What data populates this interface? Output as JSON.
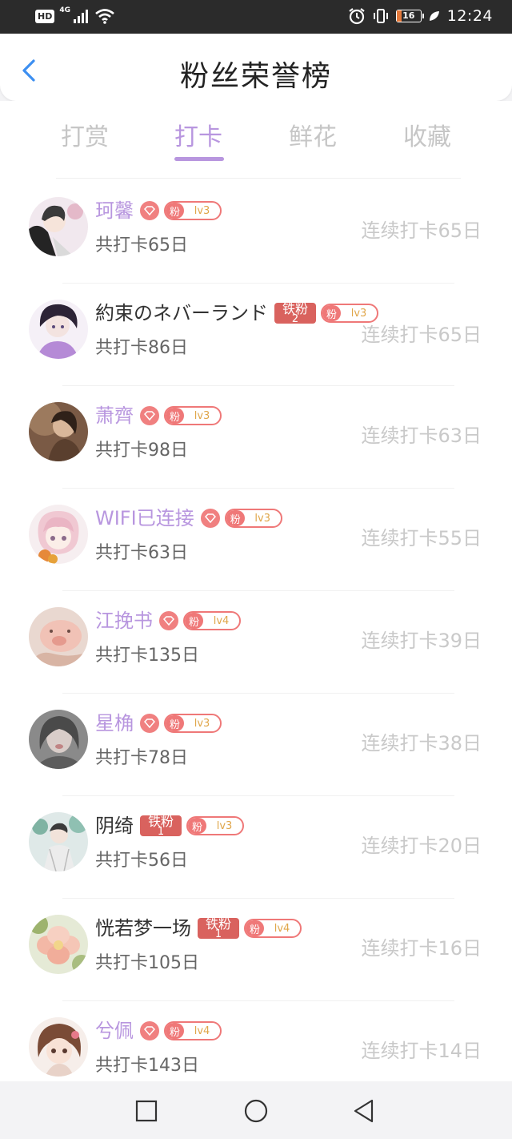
{
  "status_bar": {
    "hd": "HD",
    "network": "4G",
    "battery": "16",
    "time": "12:24"
  },
  "header": {
    "title": "粉丝荣誉榜",
    "back_icon": "chevron-left-icon"
  },
  "tabs": [
    {
      "label": "打赏",
      "active": false
    },
    {
      "label": "打卡",
      "active": true
    },
    {
      "label": "鲜花",
      "active": false
    },
    {
      "label": "收藏",
      "active": false
    }
  ],
  "colors": {
    "accent": "#b896df",
    "badge_red": "#ef7878",
    "iron_red": "#d9625e"
  },
  "list": [
    {
      "name": "珂馨",
      "vip": true,
      "badge": "diamond",
      "fan_label": "粉",
      "level": "lv3",
      "total": "共打卡65日",
      "streak": "连续打卡65日"
    },
    {
      "name": "約束のネバーランド",
      "vip": false,
      "badge": "iron",
      "iron_text": "铁粉",
      "iron_num": "2",
      "fan_label": "粉",
      "level": "lv3",
      "total": "共打卡86日",
      "streak": "连续打卡65日"
    },
    {
      "name": "萧齊",
      "vip": true,
      "badge": "diamond",
      "fan_label": "粉",
      "level": "lv3",
      "total": "共打卡98日",
      "streak": "连续打卡63日"
    },
    {
      "name": "WIFI已连接",
      "vip": true,
      "badge": "diamond",
      "fan_label": "粉",
      "level": "lv3",
      "total": "共打卡63日",
      "streak": "连续打卡55日"
    },
    {
      "name": "江挽书",
      "vip": true,
      "badge": "diamond",
      "fan_label": "粉",
      "level": "lv4",
      "total": "共打卡135日",
      "streak": "连续打卡39日"
    },
    {
      "name": "星桷",
      "vip": true,
      "badge": "diamond",
      "fan_label": "粉",
      "level": "lv3",
      "total": "共打卡78日",
      "streak": "连续打卡38日"
    },
    {
      "name": "阴绮",
      "vip": false,
      "badge": "iron",
      "iron_text": "铁粉",
      "iron_num": "1",
      "fan_label": "粉",
      "level": "lv3",
      "total": "共打卡56日",
      "streak": "连续打卡20日"
    },
    {
      "name": "恍若梦一场",
      "vip": false,
      "badge": "iron",
      "iron_text": "铁粉",
      "iron_num": "1",
      "fan_label": "粉",
      "level": "lv4",
      "total": "共打卡105日",
      "streak": "连续打卡16日"
    },
    {
      "name": "兮佩",
      "vip": true,
      "badge": "diamond",
      "fan_label": "粉",
      "level": "lv4",
      "total": "共打卡143日",
      "streak": "连续打卡14日"
    }
  ],
  "nav_bar": {
    "buttons": [
      "recents-button",
      "home-button",
      "back-button"
    ]
  }
}
